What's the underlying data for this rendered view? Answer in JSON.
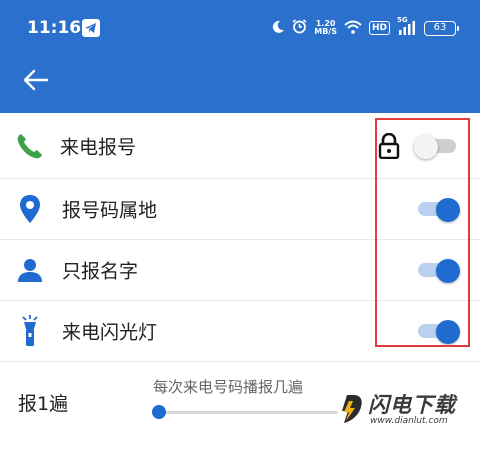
{
  "status_bar": {
    "time": "11:16",
    "speed_value": "1.20",
    "speed_unit": "MB/S",
    "hd_badge": "HD",
    "network": "5G",
    "battery": "63"
  },
  "app_bar": {
    "back_icon": "arrow-left-icon"
  },
  "settings": [
    {
      "label": "来电报号",
      "icon": "phone-icon",
      "icon_color": "#3da24a",
      "enabled": false,
      "locked": true
    },
    {
      "label": "报号码属地",
      "icon": "location-pin-icon",
      "icon_color": "#1f6bd0",
      "enabled": true
    },
    {
      "label": "只报名字",
      "icon": "person-icon",
      "icon_color": "#1f6bd0",
      "enabled": true
    },
    {
      "label": "来电闪光灯",
      "icon": "flashlight-icon",
      "icon_color": "#1f6bd0",
      "enabled": true
    }
  ],
  "repeat": {
    "label": "报1遍",
    "hint": "每次来电号码播报几遍",
    "value": 1
  },
  "watermark": {
    "brand": "闪电下载",
    "url": "www.dianlut.com"
  },
  "colors": {
    "primary": "#2a70cc",
    "accent": "#1f6bd0",
    "highlight": "#e03c3c"
  }
}
